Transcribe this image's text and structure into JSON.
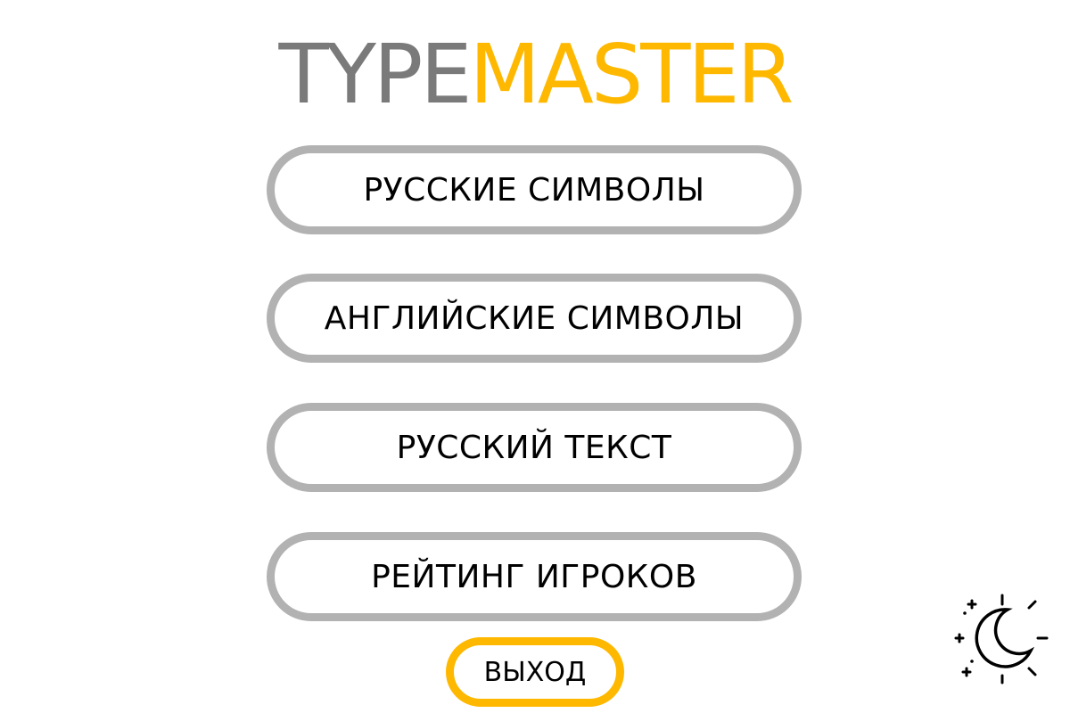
{
  "logo": {
    "part_a": "TYPE",
    "part_b": "MASTER"
  },
  "menu": {
    "items": [
      {
        "label": "РУССКИЕ СИМВОЛЫ"
      },
      {
        "label": "АНГЛИЙСКИЕ СИМВОЛЫ"
      },
      {
        "label": "РУССКИЙ ТЕКСТ"
      },
      {
        "label": "РЕЙТИНГ ИГРОКОВ"
      }
    ],
    "exit_label": "ВЫХОД"
  },
  "theme_toggle": {
    "icon": "sun-moon-icon"
  },
  "colors": {
    "accent": "#ffb800",
    "logo_gray": "#7a7a7a",
    "button_border": "#b2b2b2",
    "text": "#000000"
  }
}
